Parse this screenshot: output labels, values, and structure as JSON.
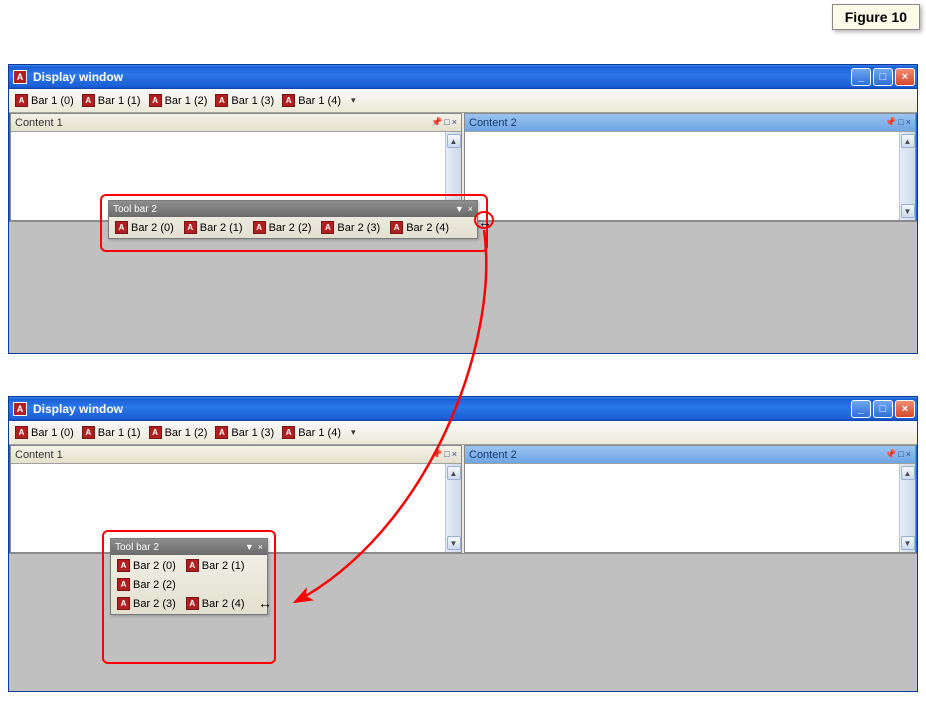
{
  "figure_label": "Figure 10",
  "window_title": "Display window",
  "bar1_items": [
    "Bar 1 (0)",
    "Bar 1 (1)",
    "Bar 1 (2)",
    "Bar 1 (3)",
    "Bar 1 (4)"
  ],
  "content_left": "Content 1",
  "content_right": "Content 2",
  "toolbar2_title": "Tool bar 2",
  "bar2_items": [
    "Bar 2 (0)",
    "Bar 2 (1)",
    "Bar 2 (2)",
    "Bar 2 (3)",
    "Bar 2 (4)"
  ],
  "icons": {
    "app": "A",
    "minimize": "_",
    "maximize": "□",
    "close": "×",
    "pin": "📌",
    "sq": "□",
    "x": "×",
    "dd": "▼",
    "up": "▲",
    "down": "▼",
    "overflow": "▾",
    "resize": "↔"
  }
}
